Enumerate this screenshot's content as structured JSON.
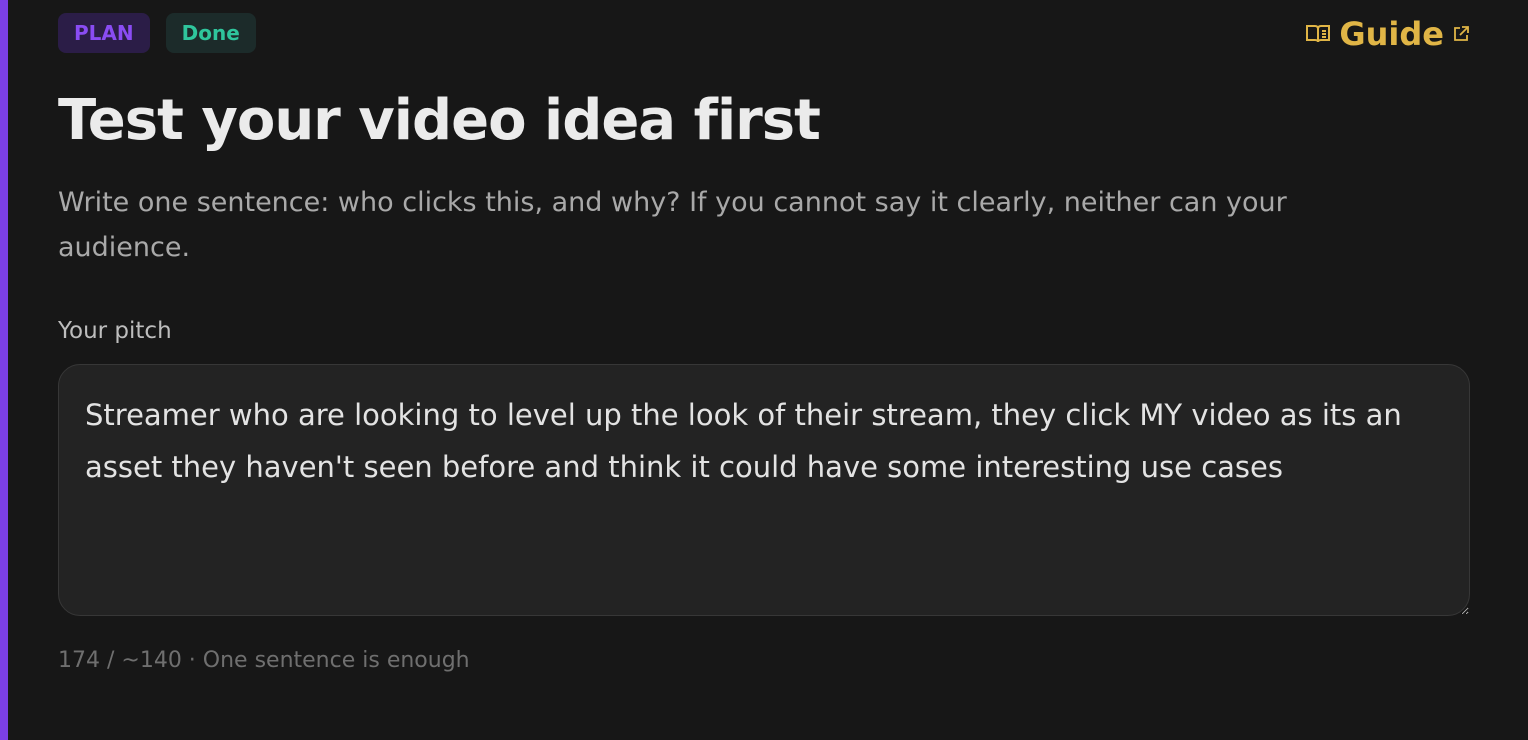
{
  "badges": {
    "plan": "PLAN",
    "status": "Done"
  },
  "guide": {
    "label": "Guide",
    "icon": "book-open-icon",
    "external_icon": "external-link-icon"
  },
  "title": "Test your video idea first",
  "subtitle": "Write one sentence: who clicks this, and why? If you cannot say it clearly, neither can your audience.",
  "pitch": {
    "label": "Your pitch",
    "value": "Streamer who are looking to level up the look of their stream, they click MY video as its an asset they haven't seen before and think it could have some interesting use cases"
  },
  "counter": "174 / ~140 · One sentence is enough",
  "colors": {
    "accent_bar": "#7b3fe4",
    "plan_badge": "#8a4cf3",
    "done_badge": "#2fc59c",
    "guide": "#e0b546"
  }
}
